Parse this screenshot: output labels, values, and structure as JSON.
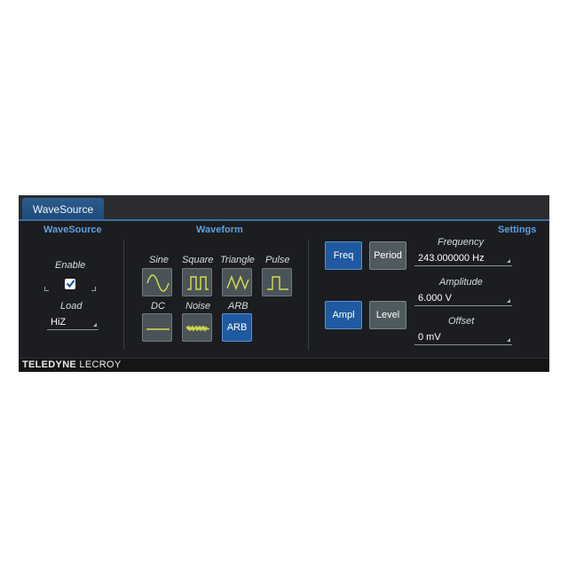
{
  "tab": {
    "label": "WaveSource"
  },
  "sections": {
    "wavesource": "WaveSource",
    "waveform": "Waveform",
    "settings": "Settings"
  },
  "wavesource": {
    "enable_label": "Enable",
    "enable_checked": true,
    "load_label": "Load",
    "load_value": "HiZ"
  },
  "waveform": {
    "sine": "Sine",
    "square": "Square",
    "triangle": "Triangle",
    "pulse": "Pulse",
    "dc": "DC",
    "noise": "Noise",
    "arb": "ARB",
    "arb_button": "ARB"
  },
  "settings": {
    "freq_button": "Freq",
    "period_button": "Period",
    "ampl_button": "Ampl",
    "level_button": "Level",
    "frequency_label": "Frequency",
    "frequency_value": "243.000000 Hz",
    "amplitude_label": "Amplitude",
    "amplitude_value": "6.000 V",
    "offset_label": "Offset",
    "offset_value": "0 mV"
  },
  "footer": {
    "brand_bold": "TELEDYNE",
    "brand_rest": " LECROY"
  },
  "colors": {
    "accent": "#5da0df",
    "button_blue": "#1f5aa0",
    "waveform_yellow": "#d8e04a",
    "panel": "#1b1d20"
  }
}
